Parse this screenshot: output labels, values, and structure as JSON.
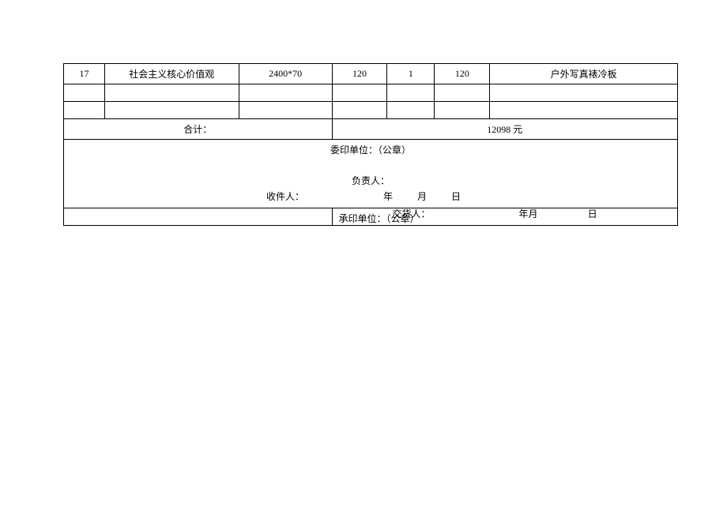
{
  "row": {
    "seq": "17",
    "name": "社会主义核心价值观",
    "spec": "2400*70",
    "price": "120",
    "qty": "1",
    "amount": "120",
    "remark": "户外写真裱冷板"
  },
  "total": {
    "label": "合计：",
    "value": "12098 元"
  },
  "sig": {
    "entrustUnit": "委印单位：（公章）",
    "principal": "负责人：",
    "recipient": "收件人：",
    "year": "年",
    "month": "月",
    "day": "日",
    "printUnit": "承印单位：（公章）",
    "deliverer": "交货人：",
    "yearMonth": "年月",
    "day2": "日"
  }
}
